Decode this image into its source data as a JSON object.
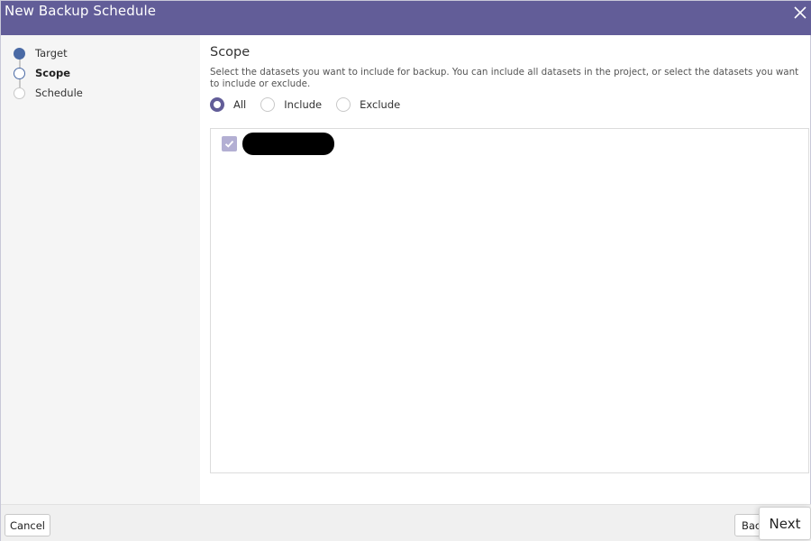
{
  "window": {
    "title": "New Backup Schedule",
    "close_icon": "close-icon"
  },
  "colors": {
    "titlebar": "#625d98",
    "step_active": "#4a6aa5",
    "radio_selected": "#625d98",
    "checkbox_checked": "#b3afd3"
  },
  "steps": [
    {
      "label": "Target",
      "state": "done"
    },
    {
      "label": "Scope",
      "state": "current"
    },
    {
      "label": "Schedule",
      "state": "todo"
    }
  ],
  "scope": {
    "title": "Scope",
    "description": "Select the datasets you want to include for backup. You can include all datasets in the project, or select the datasets you want to include or exclude.",
    "options": [
      {
        "label": "All",
        "selected": true
      },
      {
        "label": "Include",
        "selected": false
      },
      {
        "label": "Exclude",
        "selected": false
      }
    ],
    "datasets": [
      {
        "checked": true,
        "name_redacted": true
      }
    ]
  },
  "footer": {
    "cancel_label": "Cancel",
    "back_label": "Back",
    "next_label": "Next"
  }
}
